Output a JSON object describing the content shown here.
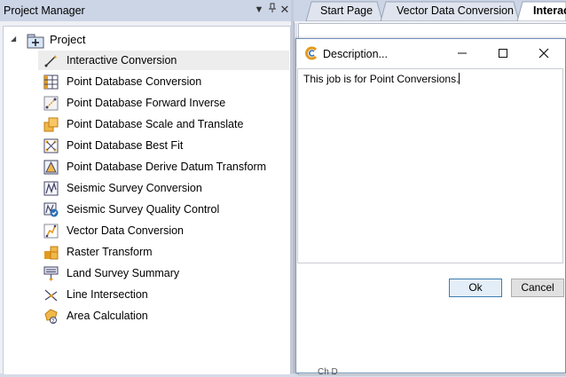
{
  "project_manager": {
    "title": "Project Manager",
    "pin_glyph": "▾",
    "root": {
      "label": "Project",
      "icon": "project-icon",
      "expanded": true
    },
    "items": [
      {
        "label": "Interactive Conversion",
        "icon": "interactive-conversion-icon",
        "selected": true
      },
      {
        "label": "Point Database Conversion",
        "icon": "point-database-conversion-icon"
      },
      {
        "label": "Point Database Forward Inverse",
        "icon": "forward-inverse-icon"
      },
      {
        "label": "Point Database Scale and Translate",
        "icon": "scale-translate-icon"
      },
      {
        "label": "Point Database Best Fit",
        "icon": "best-fit-icon"
      },
      {
        "label": "Point Database Derive Datum Transform",
        "icon": "derive-datum-icon"
      },
      {
        "label": "Seismic Survey Conversion",
        "icon": "seismic-conversion-icon"
      },
      {
        "label": "Seismic Survey Quality Control",
        "icon": "seismic-qc-icon"
      },
      {
        "label": "Vector Data Conversion",
        "icon": "vector-conversion-icon"
      },
      {
        "label": "Raster Transform",
        "icon": "raster-transform-icon"
      },
      {
        "label": "Land Survey Summary",
        "icon": "land-survey-icon"
      },
      {
        "label": "Line Intersection",
        "icon": "line-intersection-icon"
      },
      {
        "label": "Area Calculation",
        "icon": "area-calculation-icon"
      }
    ]
  },
  "tabs": [
    {
      "label": "Start Page"
    },
    {
      "label": "Vector Data Conversion"
    },
    {
      "label": "Interac",
      "active": true
    }
  ],
  "dialog": {
    "title": "Description...",
    "text": "This job is for Point Conversions.",
    "ok_label": "Ok",
    "cancel_label": "Cancel",
    "bottom_text": "Ch  D"
  },
  "colors": {
    "header_bg": "#ccd5e6",
    "selection_bg": "#ededed",
    "ok_border": "#3c7fb1"
  }
}
